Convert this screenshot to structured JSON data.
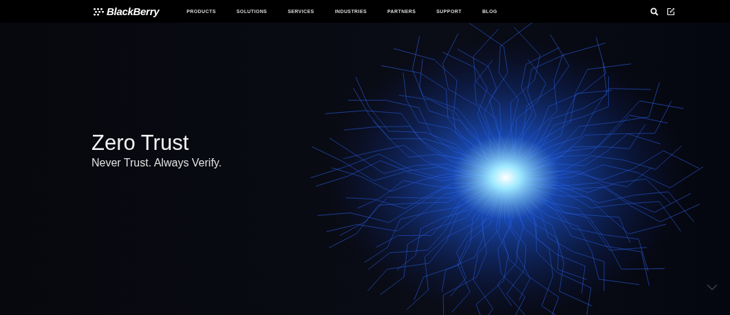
{
  "nav": {
    "logo": "BlackBerry",
    "items": [
      "PRODUCTS",
      "SOLUTIONS",
      "SERVICES",
      "INDUSTRIES",
      "PARTNERS",
      "SUPPORT",
      "BLOG"
    ]
  },
  "hero": {
    "title": "Zero Trust",
    "subtitle": "Never Trust. Always Verify."
  }
}
